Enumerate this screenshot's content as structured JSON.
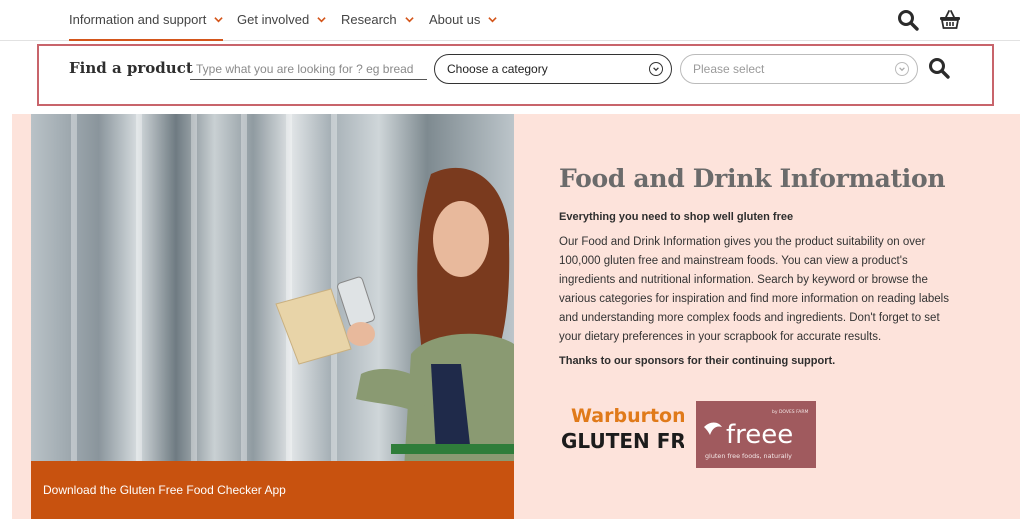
{
  "nav": {
    "items": [
      {
        "label": "Information and support"
      },
      {
        "label": "Get involved"
      },
      {
        "label": "Research"
      },
      {
        "label": "About us"
      }
    ],
    "icons": [
      "search-icon",
      "basket-icon"
    ]
  },
  "find": {
    "title": "Find a product",
    "placeholder": "Type what you are looking for ? eg bread",
    "category_value": "Choose a category",
    "sub_value": "Please select"
  },
  "hero": {
    "banner": "Download the Gluten Free Food Checker App",
    "title": "Food and Drink Information",
    "subtitle": "Everything you need to shop well gluten free",
    "body": "Our Food and Drink Information gives you the product suitability on over 100,000 gluten free and mainstream foods. You can view a product's ingredients and nutritional information. Search by keyword or browse the various categories for inspiration and find more information on reading labels and understanding more complex foods and ingredients. Don't forget to set your dietary preferences in your scrapbook for accurate results.",
    "thanks": "Thanks to our sponsors for their continuing support."
  },
  "sponsors": {
    "warburtons": {
      "line1": "Warburtons",
      "line2": "GLUTEN FREE"
    },
    "freee": {
      "tag": "by DOVES FARM",
      "name": "freee",
      "sub": "gluten free foods, naturally"
    }
  },
  "colors": {
    "accent": "#d4561b",
    "banner": "#c8520f",
    "hero_bg": "#fde3db",
    "highlight_border": "#c8646b",
    "freee_bg": "#a05a5e"
  }
}
